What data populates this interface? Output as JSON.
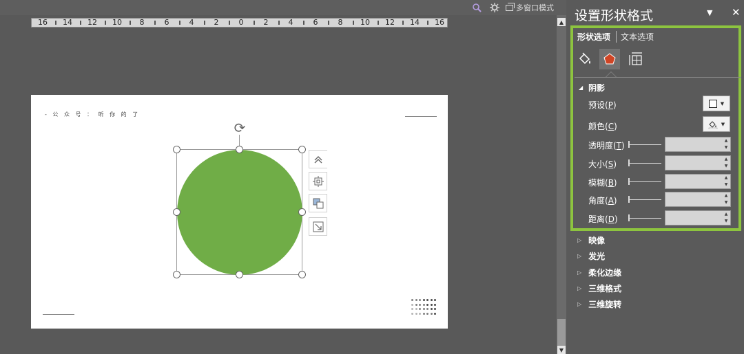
{
  "toolbar": {
    "search_icon": "search-icon",
    "gear_icon": "gear-icon",
    "multi_window_label": "多窗口模式"
  },
  "ruler": {
    "labels": [
      "16",
      "14",
      "12",
      "10",
      "8",
      "6",
      "4",
      "2",
      "0",
      "2",
      "4",
      "6",
      "8",
      "10",
      "12",
      "14",
      "16"
    ]
  },
  "slide": {
    "caption": "- 公 众 号 ： 听 你 的 了",
    "shape_fill": "#70ad47",
    "dot_colors": [
      "#b5b5b5",
      "#808080",
      "#4a4a4a"
    ]
  },
  "float_tools": [
    "layout-options-icon",
    "crop-position-icon",
    "arrange-icon",
    "resize-icon"
  ],
  "panel": {
    "title": "设置形状格式",
    "menu_glyph": "▼",
    "close_glyph": "✕",
    "tabs": {
      "shape_options": "形状选项",
      "text_options": "文本选项"
    },
    "shadow": {
      "title": "阴影",
      "preset": {
        "label": "预设(",
        "key": "P",
        "end": ")"
      },
      "color": {
        "label": "颜色(",
        "key": "C",
        "end": ")"
      },
      "transparency": {
        "label": "透明度(",
        "key": "T",
        "end": ")"
      },
      "size": {
        "label": "大小(",
        "key": "S",
        "end": ")"
      },
      "blur": {
        "label": "模糊(",
        "key": "B",
        "end": ")"
      },
      "angle": {
        "label": "角度(",
        "key": "A",
        "end": ")"
      },
      "distance": {
        "label": "距离(",
        "key": "D",
        "end": ")"
      }
    },
    "sections": [
      "映像",
      "发光",
      "柔化边缘",
      "三维格式",
      "三维旋转"
    ],
    "highlight_color": "#8dc43f",
    "effects_icon_color": "#d04525"
  }
}
